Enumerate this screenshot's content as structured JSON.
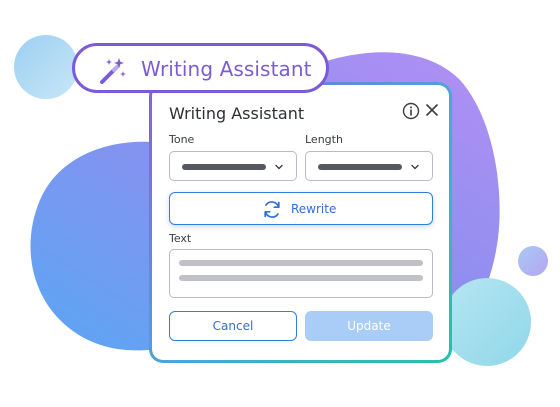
{
  "pill": {
    "label": "Writing Assistant",
    "icon": "magic-wand-icon"
  },
  "dialog": {
    "title": "Writing Assistant",
    "info_icon": "info-icon",
    "close_icon": "close-icon",
    "tone": {
      "label": "Tone",
      "value_placeholder": "selected-tone-bar"
    },
    "length": {
      "label": "Length",
      "value_placeholder": "selected-length-bar"
    },
    "rewrite_label": "Rewrite",
    "text_label": "Text",
    "cancel_label": "Cancel",
    "update_label": "Update"
  },
  "colors": {
    "accent_purple": "#7b5cd6",
    "accent_blue": "#2f7de1",
    "update_disabled": "#a9cdf7",
    "frame_gradient_start": "#8b5ce0",
    "frame_gradient_end": "#22c3a6"
  }
}
